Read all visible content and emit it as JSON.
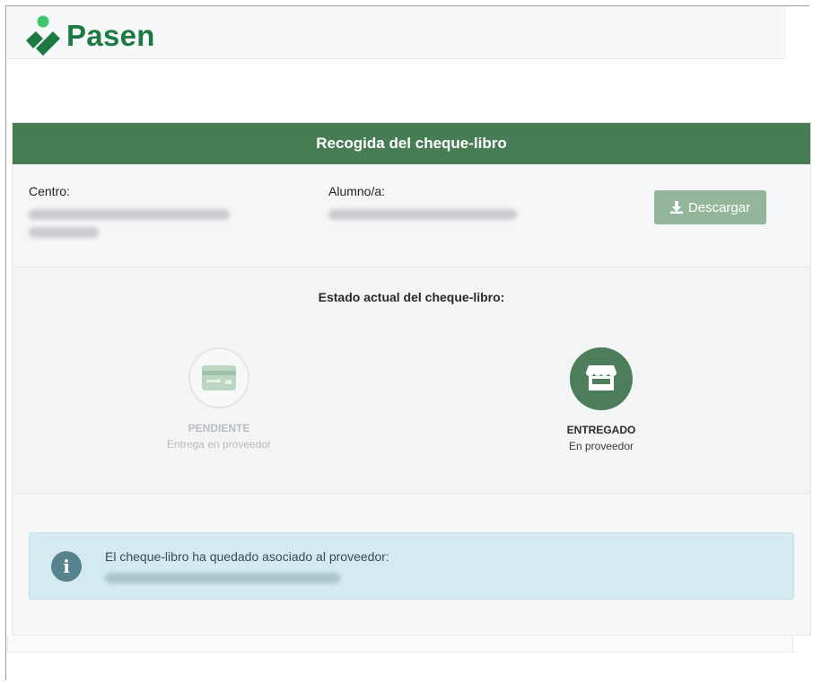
{
  "app": {
    "name": "Pasen",
    "brand_color": "#1e7a43",
    "header_color": "#477c55"
  },
  "card": {
    "title": "Recogida del cheque-libro",
    "centro_label": "Centro:",
    "alumno_label": "Alumno/a:",
    "download_label": "Descargar",
    "download_icon": "download-icon"
  },
  "status": {
    "title": "Estado actual del cheque-libro:",
    "steps": [
      {
        "name": "PENDIENTE",
        "sub": "Entrega en proveedor",
        "icon": "card-icon",
        "active": false
      },
      {
        "name": "ENTREGADO",
        "sub": "En proveedor",
        "icon": "store-icon",
        "active": true
      }
    ]
  },
  "alert": {
    "icon": "info-icon",
    "text": "El cheque-libro ha quedado asociado al proveedor:"
  }
}
